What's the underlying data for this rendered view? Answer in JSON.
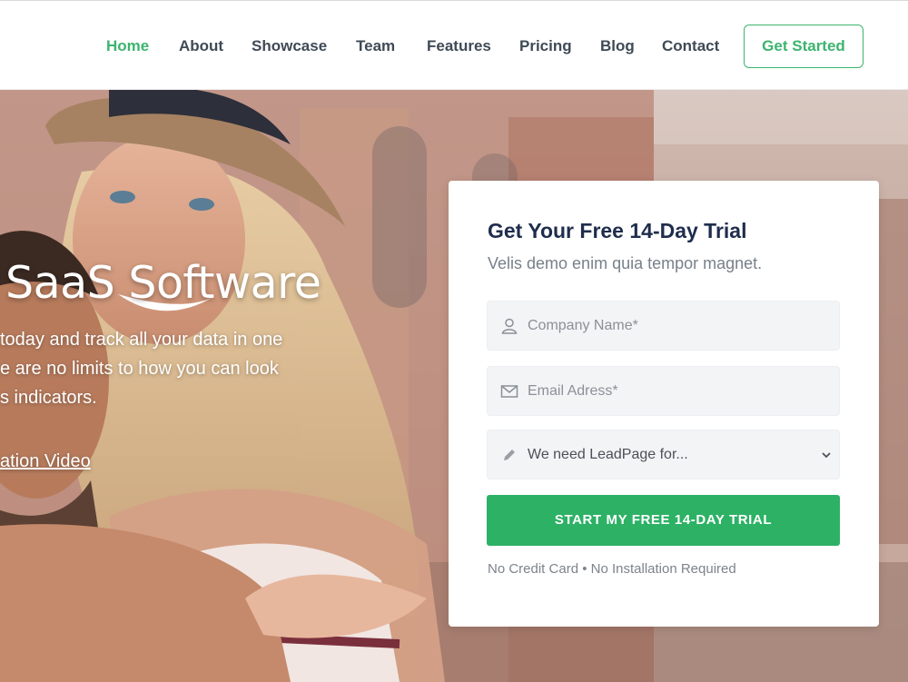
{
  "nav": {
    "items": [
      {
        "label": "Home",
        "active": true
      },
      {
        "label": "About"
      },
      {
        "label": "Showcase"
      },
      {
        "label": "Team"
      },
      {
        "label": "Features"
      },
      {
        "label": "Pricing"
      },
      {
        "label": "Blog"
      },
      {
        "label": "Contact"
      }
    ],
    "cta_label": "Get Started"
  },
  "hero": {
    "title": "SaaS Software",
    "description_lines": [
      "today and track all your data in one",
      "e are no limits to how you can look",
      "s indicators."
    ],
    "link_label": "ation Video"
  },
  "form": {
    "title": "Get Your Free 14-Day Trial",
    "subtitle": "Velis demo enim quia tempor magnet.",
    "company_placeholder": "Company Name*",
    "email_placeholder": "Email Adress*",
    "select_value": "We need LeadPage for...",
    "submit_label": "START MY FREE 14-DAY TRIAL",
    "note": "No Credit Card • No Installation Required"
  },
  "colors": {
    "accent": "#3cb46e",
    "button": "#2db165",
    "title": "#1f2d4d"
  },
  "icons": {
    "company_field": "user-icon",
    "email_field": "envelope-icon",
    "select_field": "pencil-icon",
    "select_arrow": "chevron-down-icon"
  }
}
